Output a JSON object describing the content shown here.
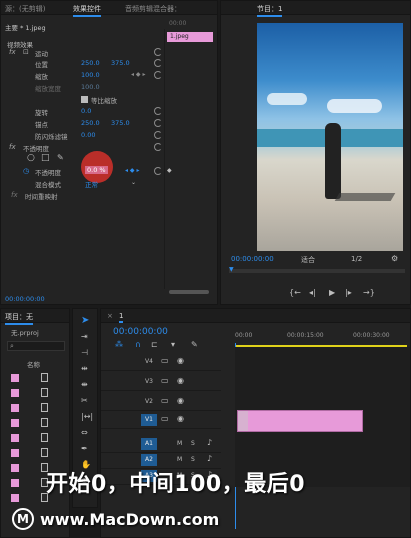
{
  "effect_controls": {
    "tabs": [
      "源：(无剪辑)",
      "效果控件",
      "音频剪辑混合器：",
      "节目"
    ],
    "clip_tab": "1.jpeg",
    "source_label": "主要 * 1.jpeg",
    "timecode_top": "00:00",
    "clip_bar_label": "1.jpeg",
    "section_video": "视频效果",
    "motion": {
      "label": "运动",
      "position_label": "位置",
      "position_x": "250.0",
      "position_y": "375.0",
      "scale_label": "缩放",
      "scale_value": "100.0",
      "scale_width_label": "缩放宽度",
      "scale_width_value": "100.0",
      "uniform_scale_label": "等比缩放",
      "rotation_label": "旋转",
      "rotation_value": "0.0",
      "anchor_label": "锚点",
      "anchor_x": "250.0",
      "anchor_y": "375.0",
      "flicker_label": "防闪烁滤镜",
      "flicker_value": "0.00"
    },
    "opacity": {
      "label": "不透明度",
      "opacity_label": "不透明度",
      "opacity_value": "0.0 %",
      "blend_label": "混合模式",
      "blend_value": "正常"
    },
    "time_remap_label": "时间重映射",
    "bottom_timecode": "00:00:00:00"
  },
  "program": {
    "tab": "节目：1",
    "timecode": "00:00:00:00",
    "fit": "适合",
    "quality": "1/2"
  },
  "project": {
    "tab": "项目：无",
    "name": "无.prproj",
    "col_name": "名称",
    "item_count": 9
  },
  "timeline": {
    "tab": "1",
    "timecode": "00:00:00:00",
    "ruler": [
      "00:00",
      "00:00:15:00",
      "00:00:30:00"
    ],
    "tracks": [
      {
        "name": "V4",
        "on": false
      },
      {
        "name": "V3",
        "on": false
      },
      {
        "name": "V2",
        "on": false
      },
      {
        "name": "V1",
        "on": true
      },
      {
        "name": "A1",
        "on": true
      },
      {
        "name": "A2",
        "on": true
      },
      {
        "name": "A3",
        "on": true
      }
    ],
    "track_letters": [
      "M",
      "S"
    ]
  },
  "overlay": {
    "caption": "开始0，中间100，最后0",
    "watermark": "www.MacDown.com"
  },
  "colors": {
    "accent": "#2d8ceb",
    "clip_pink": "#e79ad9",
    "keyframe_red": "#c8302a",
    "work_area": "#e0d21a"
  }
}
